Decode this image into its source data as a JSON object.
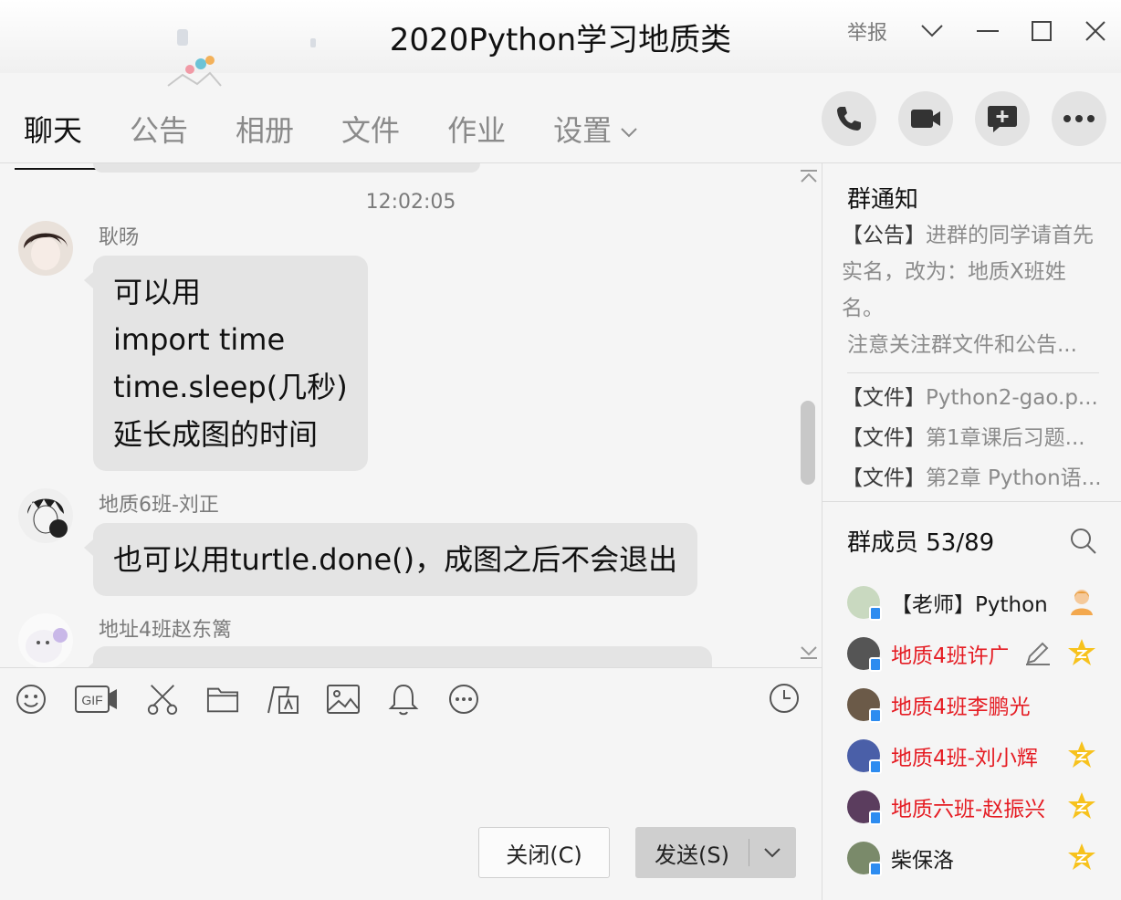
{
  "window": {
    "title": "2020Python学习地质类",
    "report_label": "举报"
  },
  "tabs": [
    {
      "label": "聊天",
      "active": true
    },
    {
      "label": "公告",
      "active": false
    },
    {
      "label": "相册",
      "active": false
    },
    {
      "label": "文件",
      "active": false
    },
    {
      "label": "作业",
      "active": false
    },
    {
      "label": "设置",
      "active": false
    }
  ],
  "actions": [
    "phone-call",
    "video-call",
    "new-discussion",
    "more"
  ],
  "chat": {
    "timestamp": "12:02:05",
    "messages": [
      {
        "sender": "耿旸",
        "lines": [
          "可以用",
          "import time",
          "time.sleep(几秒)",
          "延长成图的时间"
        ]
      },
      {
        "sender": "地质6班-刘正",
        "lines": [
          "也可以用turtle.done()，成图之后不会退出"
        ]
      },
      {
        "sender": "地址4班赵东篱",
        "lines": []
      }
    ]
  },
  "toolbar": {
    "tools": [
      "emoji",
      "gif",
      "screenshot",
      "folder",
      "fonts",
      "image",
      "bell",
      "more"
    ],
    "gif_label": "GIF"
  },
  "buttons": {
    "close_label": "关闭(C)",
    "send_label": "发送(S)"
  },
  "notice": {
    "title": "群通知",
    "tag": "【公告】",
    "text": "进群的同学请首先实名，改为：地质X班姓名。",
    "text2": "注意关注群文件和公告..."
  },
  "files": [
    {
      "tag": "【文件】",
      "name": "Python2-gao.p..."
    },
    {
      "tag": "【文件】",
      "name": "第1章课后习题..."
    },
    {
      "tag": "【文件】",
      "name": "第2章 Python语..."
    }
  ],
  "members": {
    "title": "群成员 53/89",
    "items": [
      {
        "name": "【老师】Python",
        "admin": false,
        "badge": "owner"
      },
      {
        "name": "地质4班许广",
        "admin": true,
        "badge": "admin"
      },
      {
        "name": "地质4班李鹏光",
        "admin": true,
        "badge": ""
      },
      {
        "name": "地质4班-刘小辉",
        "admin": true,
        "badge": "admin"
      },
      {
        "name": "地质六班-赵振兴",
        "admin": true,
        "badge": "admin"
      },
      {
        "name": "柴保洛",
        "admin": false,
        "badge": "admin"
      }
    ]
  },
  "colors": {
    "admin_name": "#e51c23",
    "badge_star": "#f7c21d",
    "bubble": "#e4e4e4"
  }
}
